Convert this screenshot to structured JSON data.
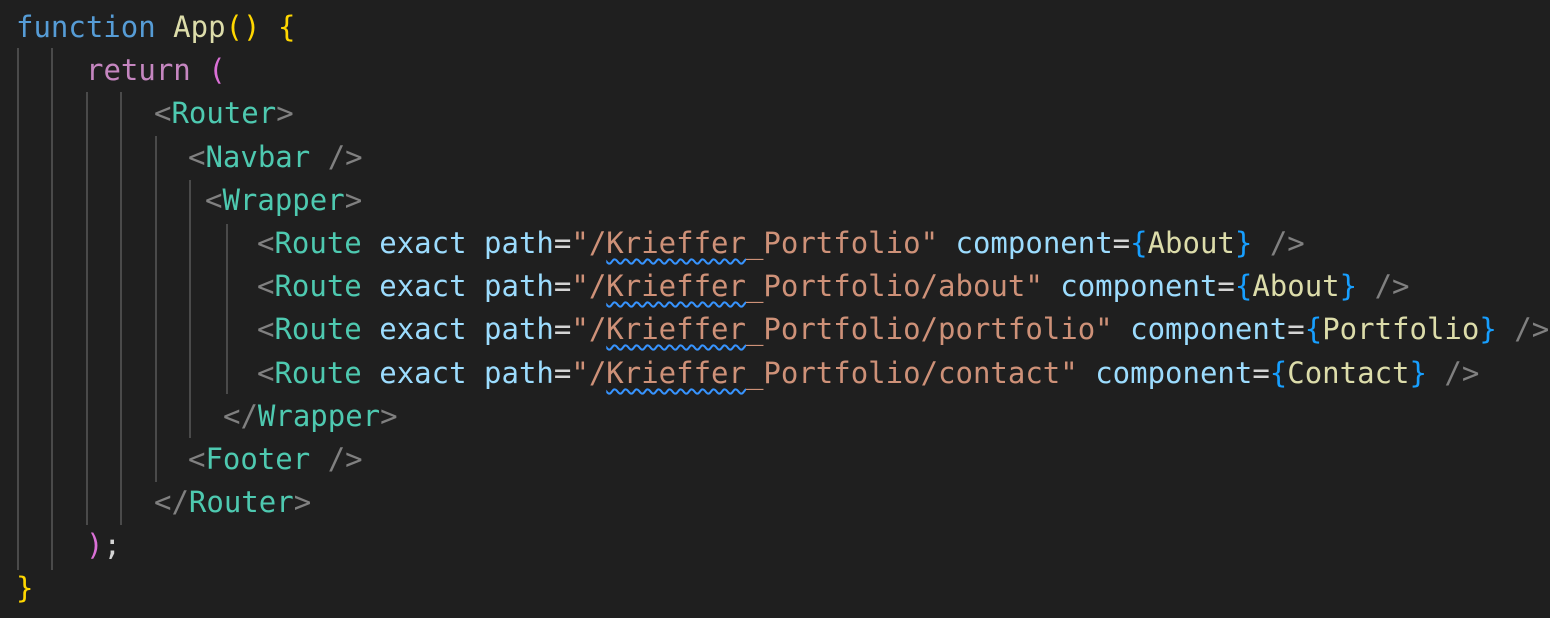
{
  "colors": {
    "background": "#1f1f1f",
    "keyword_function": "#569cd6",
    "keyword_control": "#c586c0",
    "function_name": "#dcdcaa",
    "bracket_level1": "#ffd700",
    "bracket_level2": "#da70d6",
    "bracket_level3": "#179fff",
    "tag_punctuation": "#808080",
    "tag_name": "#4ec9b0",
    "attribute": "#9cdcfe",
    "string": "#ce9178",
    "spelling_squiggle": "#3794ff"
  },
  "code": {
    "l1": {
      "kw": "function",
      "name": "App",
      "paren_open": "(",
      "paren_close": ")",
      "brace": "{"
    },
    "l2": {
      "kw": "return",
      "paren": "("
    },
    "l3": {
      "open": "<",
      "tag": "Router",
      "close": ">"
    },
    "l4": {
      "open": "<",
      "tag": "Navbar",
      "selfclose": "/>"
    },
    "l5": {
      "open": "<",
      "tag": "Wrapper",
      "close": ">"
    },
    "routes": [
      {
        "open": "<",
        "tag": "Route",
        "exact": "exact",
        "path_attr": "path",
        "eq": "=",
        "q1": "\"",
        "slash": "/",
        "word": "Krieffer",
        "rest": "_Portfolio",
        "q2": "\"",
        "comp_attr": "component",
        "eq2": "=",
        "bo": "{",
        "comp": "About",
        "bc": "}",
        "selfclose": "/>"
      },
      {
        "open": "<",
        "tag": "Route",
        "exact": "exact",
        "path_attr": "path",
        "eq": "=",
        "q1": "\"",
        "slash": "/",
        "word": "Krieffer",
        "rest": "_Portfolio/about",
        "q2": "\"",
        "comp_attr": "component",
        "eq2": "=",
        "bo": "{",
        "comp": "About",
        "bc": "}",
        "selfclose": "/>"
      },
      {
        "open": "<",
        "tag": "Route",
        "exact": "exact",
        "path_attr": "path",
        "eq": "=",
        "q1": "\"",
        "slash": "/",
        "word": "Krieffer",
        "rest": "_Portfolio/portfolio",
        "q2": "\"",
        "comp_attr": "component",
        "eq2": "=",
        "bo": "{",
        "comp": "Portfolio",
        "bc": "}",
        "selfclose": "/>"
      },
      {
        "open": "<",
        "tag": "Route",
        "exact": "exact",
        "path_attr": "path",
        "eq": "=",
        "q1": "\"",
        "slash": "/",
        "word": "Krieffer",
        "rest": "_Portfolio/contact",
        "q2": "\"",
        "comp_attr": "component",
        "eq2": "=",
        "bo": "{",
        "comp": "Contact",
        "bc": "}",
        "selfclose": "/>"
      }
    ],
    "l10": {
      "open": "</",
      "tag": "Wrapper",
      "close": ">"
    },
    "l11": {
      "open": "<",
      "tag": "Footer",
      "selfclose": "/>"
    },
    "l12": {
      "open": "</",
      "tag": "Router",
      "close": ">"
    },
    "l13": {
      "paren": ")",
      "semi": ";"
    },
    "l14": {
      "brace": "}"
    }
  }
}
